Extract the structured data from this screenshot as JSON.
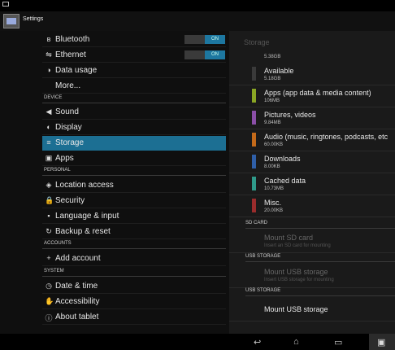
{
  "app": {
    "title": "Settings"
  },
  "left": {
    "items": [
      {
        "label": "Bluetooth",
        "icon": "bluetooth-icon",
        "glyph": "ʙ",
        "toggle": "ON"
      },
      {
        "label": "Ethernet",
        "icon": "ethernet-icon",
        "glyph": "⇋",
        "toggle": "ON"
      },
      {
        "label": "Data usage",
        "icon": "data-usage-icon",
        "glyph": "◑"
      },
      {
        "label": "More...",
        "icon": "",
        "glyph": ""
      }
    ],
    "section_device": "DEVICE",
    "device_items": [
      {
        "label": "Sound",
        "icon": "sound-icon",
        "glyph": "◀"
      },
      {
        "label": "Display",
        "icon": "display-icon",
        "glyph": "◐"
      },
      {
        "label": "Storage",
        "icon": "storage-icon",
        "glyph": "≡"
      },
      {
        "label": "Apps",
        "icon": "apps-icon",
        "glyph": "▣"
      }
    ],
    "section_personal": "PERSONAL",
    "personal_items": [
      {
        "label": "Location access",
        "icon": "location-icon",
        "glyph": "◈"
      },
      {
        "label": "Security",
        "icon": "lock-icon",
        "glyph": "🔒"
      },
      {
        "label": "Language & input",
        "icon": "keyboard-icon",
        "glyph": "▪"
      },
      {
        "label": "Backup & reset",
        "icon": "backup-icon",
        "glyph": "↻"
      }
    ],
    "section_accounts": "ACCOUNTS",
    "accounts_items": [
      {
        "label": "Add account",
        "icon": "add-icon",
        "glyph": "+"
      }
    ],
    "section_system": "SYSTEM",
    "system_items": [
      {
        "label": "Date & time",
        "icon": "clock-icon",
        "glyph": "◷"
      },
      {
        "label": "Accessibility",
        "icon": "accessibility-icon",
        "glyph": "✋"
      },
      {
        "label": "About tablet",
        "icon": "info-icon",
        "glyph": "ⓘ"
      }
    ]
  },
  "right": {
    "title": "Storage",
    "partial_sub": "5.38GB",
    "items": [
      {
        "title": "Available",
        "sub": "5.18GB",
        "color": "#3a3a3a"
      },
      {
        "title": "Apps (app data & media content)",
        "sub": "106MB",
        "color": "#8aa624"
      },
      {
        "title": "Pictures, videos",
        "sub": "9.84MB",
        "color": "#8b4fa8"
      },
      {
        "title": "Audio (music, ringtones, podcasts, etc",
        "sub": "60.00KB",
        "color": "#c46a1a"
      },
      {
        "title": "Downloads",
        "sub": "8.00KB",
        "color": "#2f5fa8"
      },
      {
        "title": "Cached data",
        "sub": "10.73MB",
        "color": "#2f9a8a"
      },
      {
        "title": "Misc.",
        "sub": "20.00KB",
        "color": "#9a2c2c"
      }
    ],
    "sd_card_header": "SD CARD",
    "mount_sd_title": "Mount SD card",
    "mount_sd_sub": "Insert an SD card for mounting",
    "usb_header_1": "USB STORAGE",
    "mount_usb_title_1": "Mount USB storage",
    "mount_usb_sub_1": "Insert USB storage for mounting",
    "usb_header_2": "USB STORAGE",
    "mount_usb_title_2": "Mount USB storage"
  },
  "nav": {
    "back": "↩",
    "home": "⌂",
    "recents": "▭",
    "screenshot": "▣"
  }
}
